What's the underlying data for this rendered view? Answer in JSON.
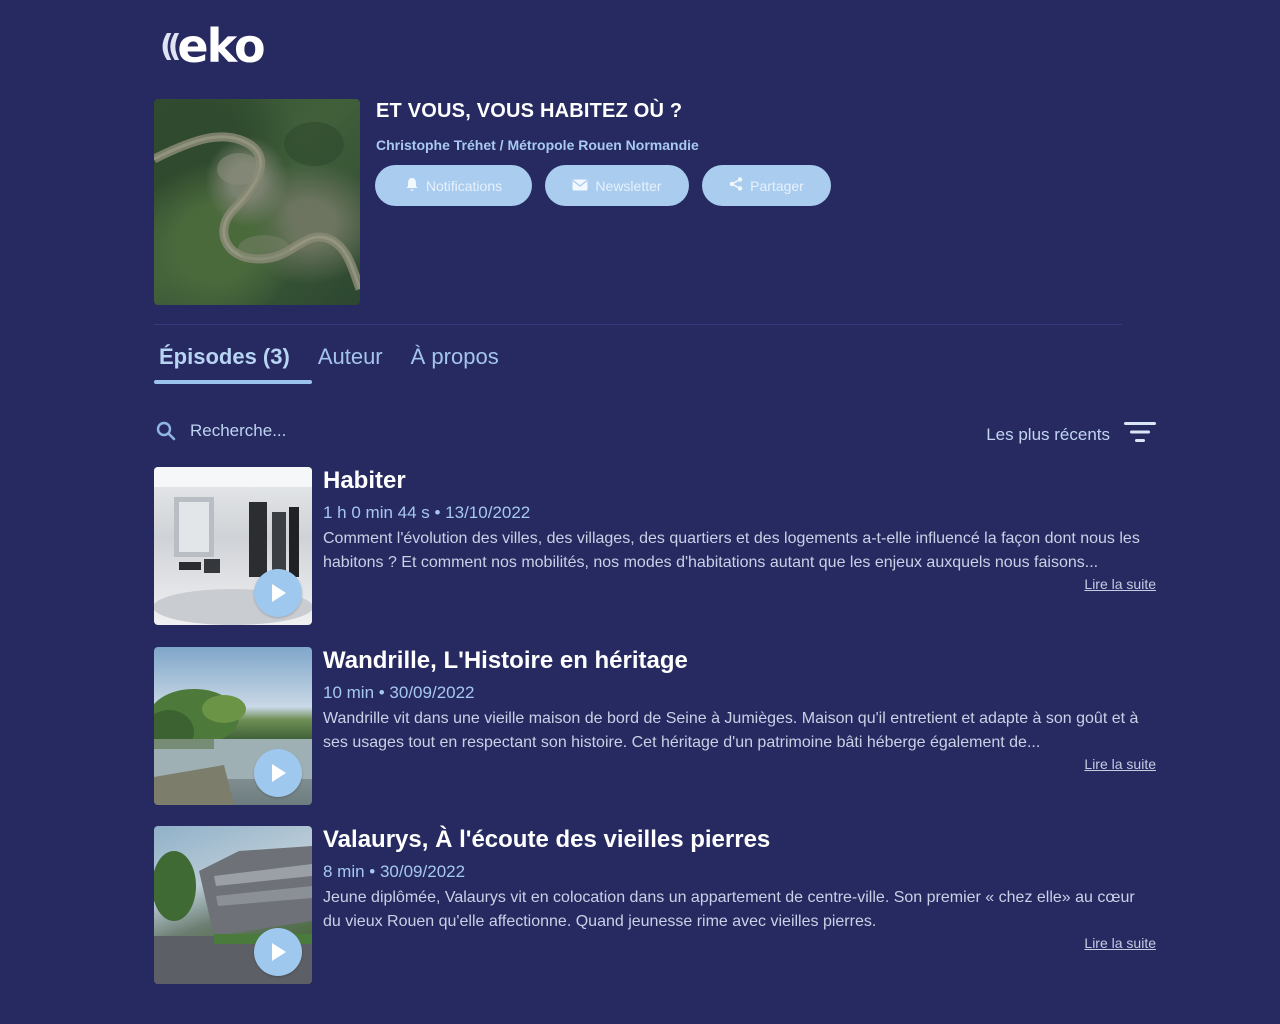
{
  "brand": {
    "name": "eko"
  },
  "podcast": {
    "title": "ET VOUS, VOUS HABITEZ OÙ ?",
    "author": "Christophe Tréhet / Métropole Rouen Normandie",
    "actions": {
      "notifications": "Notifications",
      "newsletter": "Newsletter",
      "share": "Partager"
    }
  },
  "tabs": {
    "episodes": "Épisodes (3)",
    "author": "Auteur",
    "about": "À propos"
  },
  "search": {
    "placeholder": "Recherche..."
  },
  "sort": {
    "label": "Les plus récents"
  },
  "episodes": [
    {
      "title": "Habiter",
      "meta": "1 h 0 min 44 s • 13/10/2022",
      "desc": "Comment l'évolution des villes, des villages, des quartiers et des logements a-t-elle influencé la façon dont nous les habitons ? Et comment nos mobilités, nos modes d'habitations autant que les enjeux auxquels nous faisons...",
      "more": "Lire la suite"
    },
    {
      "title": "Wandrille, L'Histoire en héritage",
      "meta": "10 min • 30/09/2022",
      "desc": "Wandrille vit dans une vieille maison de bord de Seine à Jumièges.  Maison qu'il entretient et adapte à son goût et à ses usages tout en  respectant son histoire. Cet héritage d'un patrimoine bâti héberge  également de...",
      "more": "Lire la suite"
    },
    {
      "title": "Valaurys, À l'écoute des vieilles pierres",
      "meta": "8 min • 30/09/2022",
      "desc": "Jeune diplômée, Valaurys vit en colocation dans un appartement de  centre-ville. Son premier « chez elle» au cœur du vieux Rouen qu'elle  affectionne. Quand jeunesse rime avec vieilles pierres.",
      "more": "Lire la suite"
    }
  ],
  "icons": {
    "notifications": "bell-icon",
    "newsletter": "envelope-icon",
    "share": "share-icon",
    "search": "search-icon",
    "sort": "sort-icon",
    "play": "play-icon"
  },
  "colors": {
    "background": "#262a60",
    "accent": "#a9ccef",
    "link": "#a6c8ef"
  }
}
